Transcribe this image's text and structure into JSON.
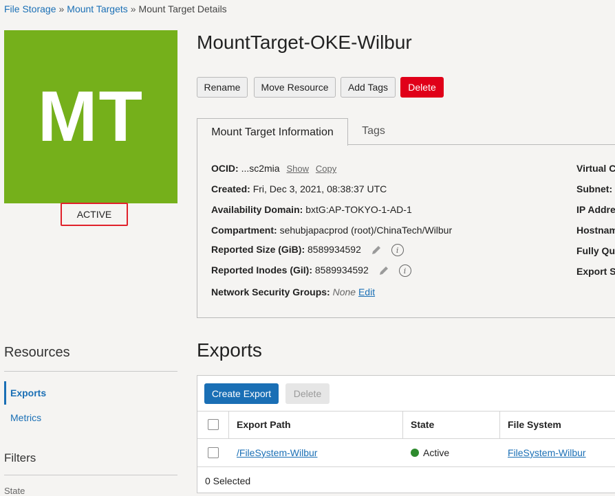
{
  "breadcrumb": {
    "items": [
      "File Storage",
      "Mount Targets",
      "Mount Target Details"
    ],
    "separator": "»"
  },
  "tile": {
    "initials": "MT",
    "color": "#75b01b"
  },
  "status": {
    "label": "ACTIVE"
  },
  "title": "MountTarget-OKE-Wilbur",
  "actions": {
    "rename": "Rename",
    "move": "Move Resource",
    "add_tags": "Add Tags",
    "delete": "Delete"
  },
  "tabs": {
    "info": "Mount Target Information",
    "tags": "Tags"
  },
  "info": {
    "ocid_label": "OCID:",
    "ocid_value": "...sc2mia",
    "show": "Show",
    "copy": "Copy",
    "created_label": "Created:",
    "created_value": "Fri, Dec 3, 2021, 08:38:37 UTC",
    "ad_label": "Availability Domain:",
    "ad_value": "bxtG:AP-TOKYO-1-AD-1",
    "compartment_label": "Compartment:",
    "compartment_value": "sehubjapacprod (root)/ChinaTech/Wilbur",
    "size_label": "Reported Size (GiB):",
    "size_value": "8589934592",
    "inodes_label": "Reported Inodes (GiI):",
    "inodes_value": "8589934592",
    "nsg_label": "Network Security Groups:",
    "nsg_value": "None",
    "nsg_edit": "Edit",
    "right": [
      "Virtual C",
      "Subnet:",
      "IP Addre",
      "Hostnam",
      "Fully Qu",
      "Export S"
    ]
  },
  "resources": {
    "heading": "Resources",
    "items": [
      "Exports",
      "Metrics"
    ],
    "filters_heading": "Filters",
    "filter_state": "State"
  },
  "exports": {
    "title": "Exports",
    "create": "Create Export",
    "delete": "Delete",
    "columns": [
      "Export Path",
      "State",
      "File System"
    ],
    "rows": [
      {
        "path": "/FileSystem-Wilbur",
        "state": "Active",
        "file_system": "FileSystem-Wilbur"
      }
    ],
    "selected": "0 Selected"
  }
}
